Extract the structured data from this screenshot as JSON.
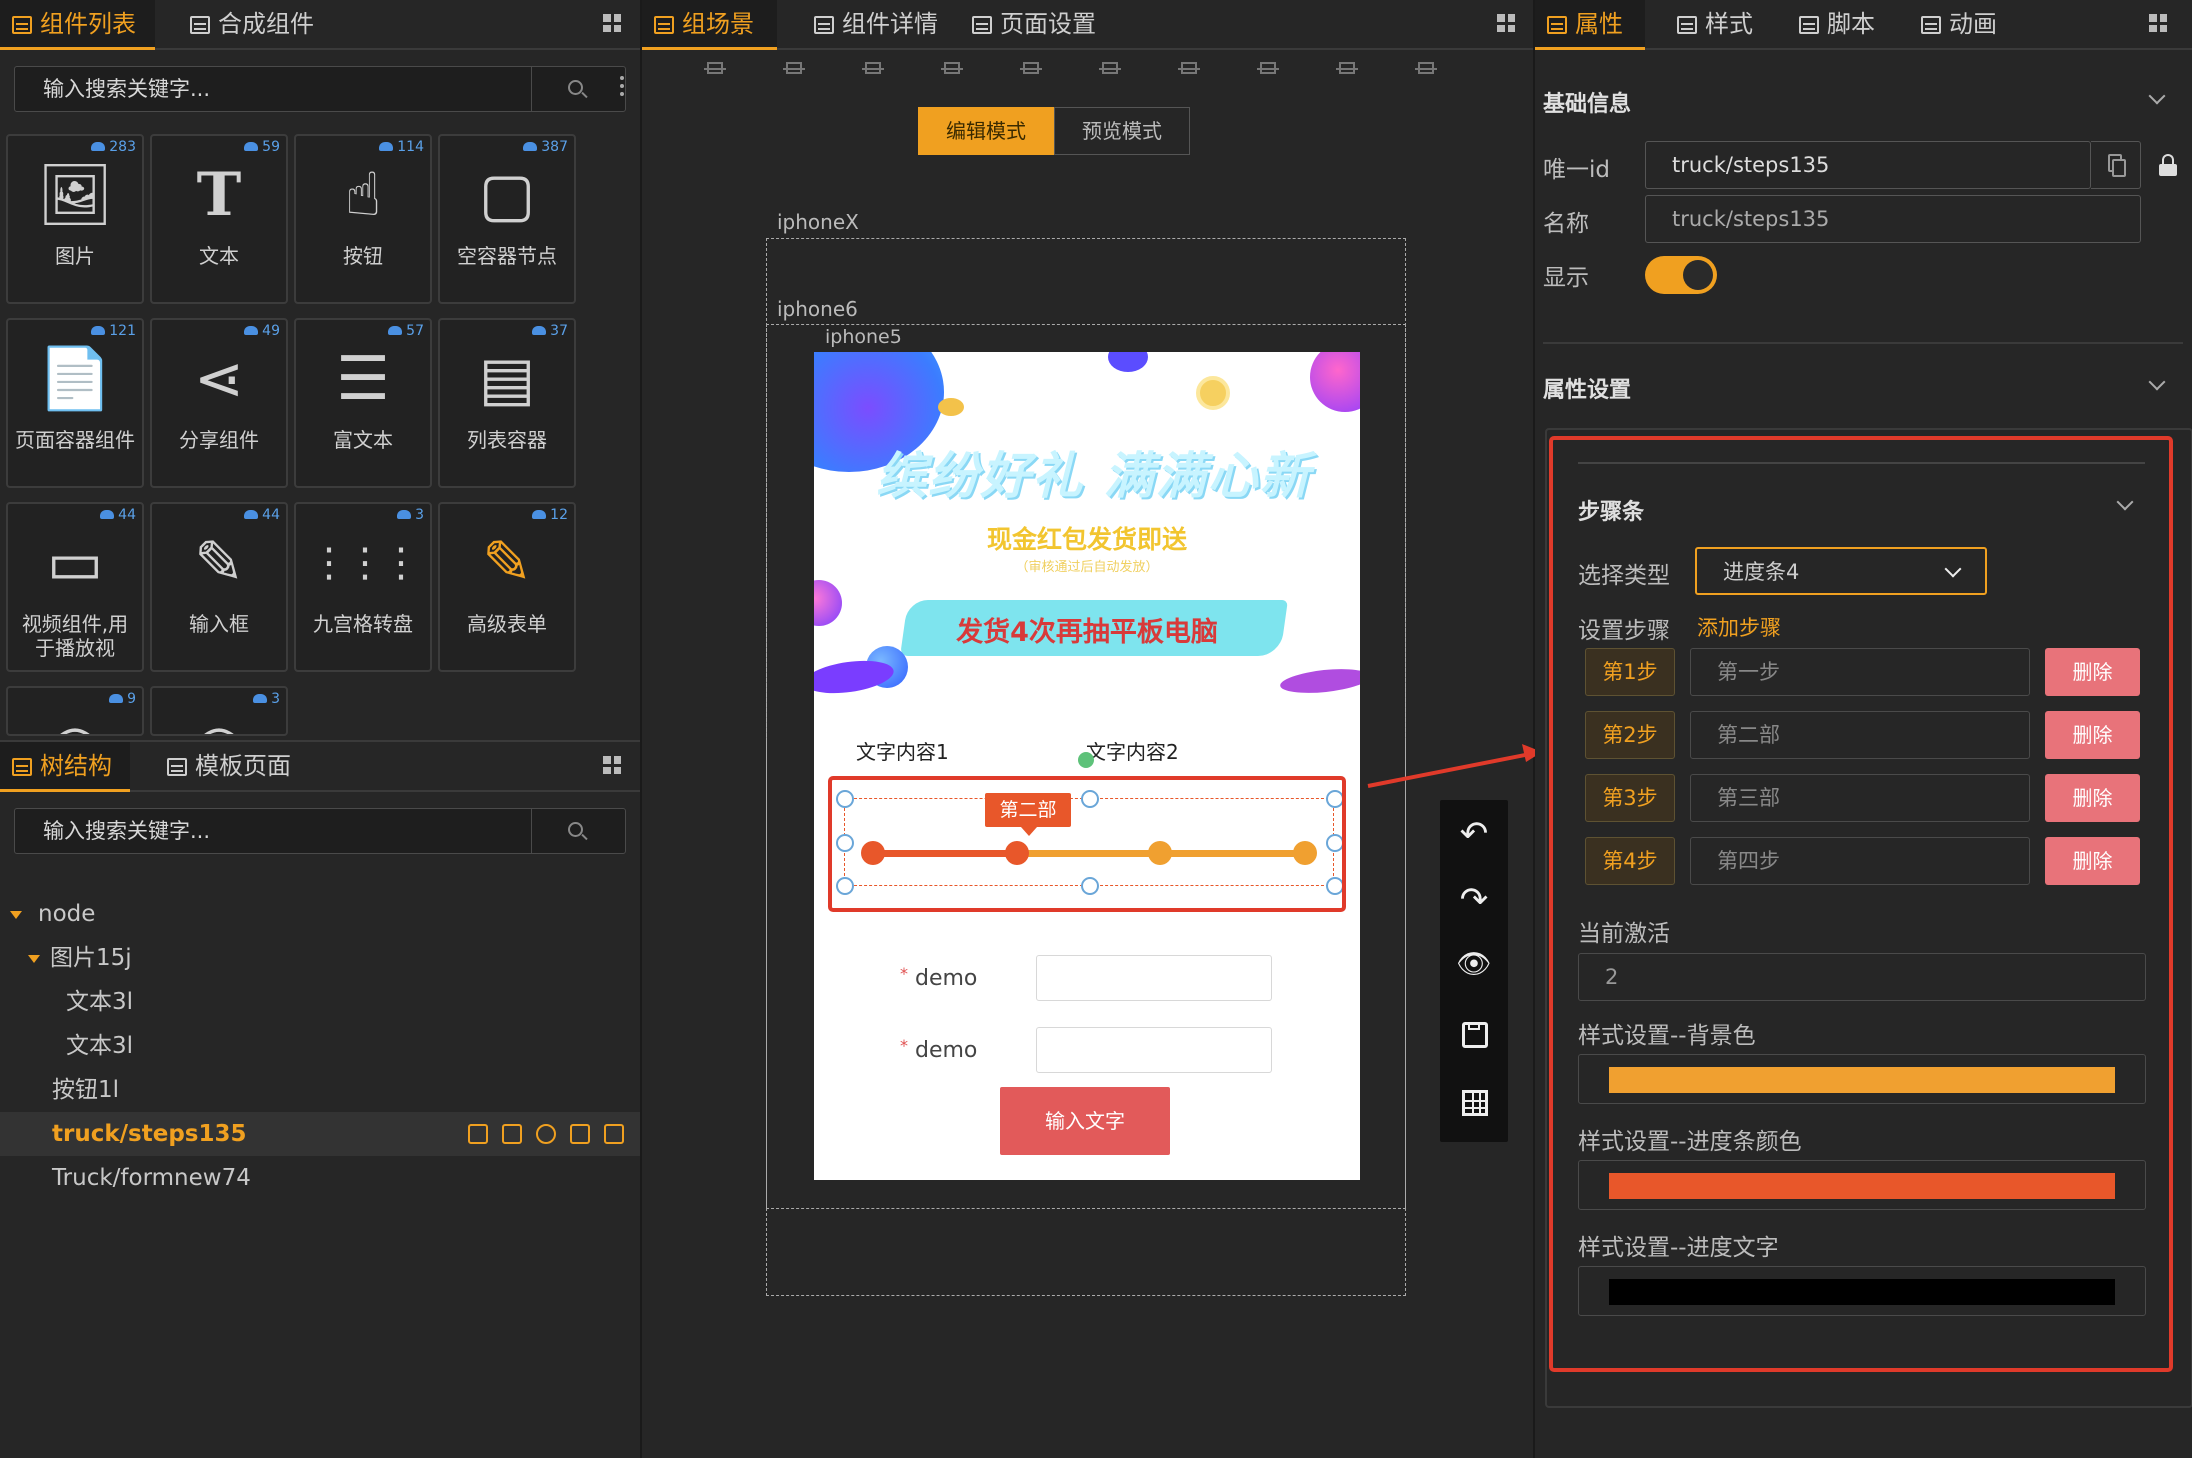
{
  "left_panel": {
    "tabs": [
      {
        "label": "组件列表",
        "active": true
      },
      {
        "label": "合成组件",
        "active": false
      }
    ],
    "search_placeholder": "输入搜索关键字...",
    "components": [
      {
        "label": "图片",
        "count": "283",
        "icon": "image-icon"
      },
      {
        "label": "文本",
        "count": "59",
        "icon": "text-icon"
      },
      {
        "label": "按钮",
        "count": "114",
        "icon": "pointer-hand-icon"
      },
      {
        "label": "空容器节点",
        "count": "387",
        "icon": "empty-container-icon"
      },
      {
        "label": "页面容器组件",
        "count": "121",
        "icon": "page-icon"
      },
      {
        "label": "分享组件",
        "count": "49",
        "icon": "share-icon"
      },
      {
        "label": "富文本",
        "count": "57",
        "icon": "rich-text-icon"
      },
      {
        "label": "列表容器",
        "count": "37",
        "icon": "list-icon"
      },
      {
        "label": "视频组件,用于播放视",
        "count": "44",
        "icon": "video-icon"
      },
      {
        "label": "输入框",
        "count": "44",
        "icon": "pen-icon"
      },
      {
        "label": "九宫格转盘",
        "count": "3",
        "icon": "nine-grid-icon"
      },
      {
        "label": "高级表单",
        "count": "12",
        "icon": "form-edit-icon"
      },
      {
        "label": "",
        "count": "9",
        "icon": "partial-icon"
      },
      {
        "label": "",
        "count": "3",
        "icon": "partial-icon"
      }
    ]
  },
  "tree_panel": {
    "tabs": [
      {
        "label": "树结构",
        "active": true
      },
      {
        "label": "模板页面",
        "active": false
      }
    ],
    "search_placeholder": "输入搜索关键字...",
    "nodes": [
      {
        "label": "node",
        "indent": 0,
        "caret": true
      },
      {
        "label": "图片15j",
        "indent": 1,
        "caret": true
      },
      {
        "label": "文本3l",
        "indent": 2,
        "caret": false
      },
      {
        "label": "文本3l",
        "indent": 2,
        "caret": false
      },
      {
        "label": "按钮1l",
        "indent": 1,
        "caret": false
      },
      {
        "label": "truck/steps135",
        "indent": 1,
        "caret": false,
        "selected": true
      },
      {
        "label": "Truck/formnew74",
        "indent": 1,
        "caret": false
      }
    ]
  },
  "center_panel": {
    "tabs": [
      {
        "label": "组场景",
        "active": true
      },
      {
        "label": "组件详情",
        "active": false
      },
      {
        "label": "页面设置",
        "active": false
      }
    ],
    "mode_edit": "编辑模式",
    "mode_preview": "预览模式",
    "devices": [
      "iphoneX",
      "iphone6",
      "iphone5"
    ],
    "banner": {
      "headline": "缤纷好礼 满满心新",
      "subline": "现金红包发货即送",
      "note": "（审核通过后自动发放）",
      "ribbon": "发货4次再抽平板电脑"
    },
    "steps": {
      "text1": "文字内容1",
      "text2": "文字内容2",
      "tooltip": "第二部",
      "count": 4,
      "active": 2
    },
    "form": {
      "label1": "demo",
      "label2": "demo",
      "submit": "输入文字"
    }
  },
  "right_panel": {
    "tabs": [
      {
        "label": "属性",
        "active": true
      },
      {
        "label": "样式",
        "active": false
      },
      {
        "label": "脚本",
        "active": false
      },
      {
        "label": "动画",
        "active": false
      }
    ],
    "basic_title": "基础信息",
    "id_label": "唯一id",
    "id_value": "truck/steps135",
    "name_label": "名称",
    "name_value": "truck/steps135",
    "show_label": "显示",
    "prop_title": "属性设置",
    "steps_title": "步骤条",
    "type_label": "选择类型",
    "type_value": "进度条4",
    "set_steps_label": "设置步骤",
    "add_step": "添加步骤",
    "step_rows": [
      {
        "tag": "第1步",
        "value": "第一步",
        "del": "删除"
      },
      {
        "tag": "第2步",
        "value": "第二部",
        "del": "删除"
      },
      {
        "tag": "第3步",
        "value": "第三部",
        "del": "删除"
      },
      {
        "tag": "第4步",
        "value": "第四步",
        "del": "删除"
      }
    ],
    "active_label": "当前激活",
    "active_value": "2",
    "bg_label": "样式设置--背景色",
    "bar_label": "样式设置--进度条颜色",
    "text_label": "样式设置--进度文字"
  },
  "colors": {
    "accent": "#f0a020",
    "progress_bg": "#f0a030",
    "progress_bar": "#e8572a",
    "progress_text": "#000000",
    "highlight_red": "#e03a2a"
  }
}
